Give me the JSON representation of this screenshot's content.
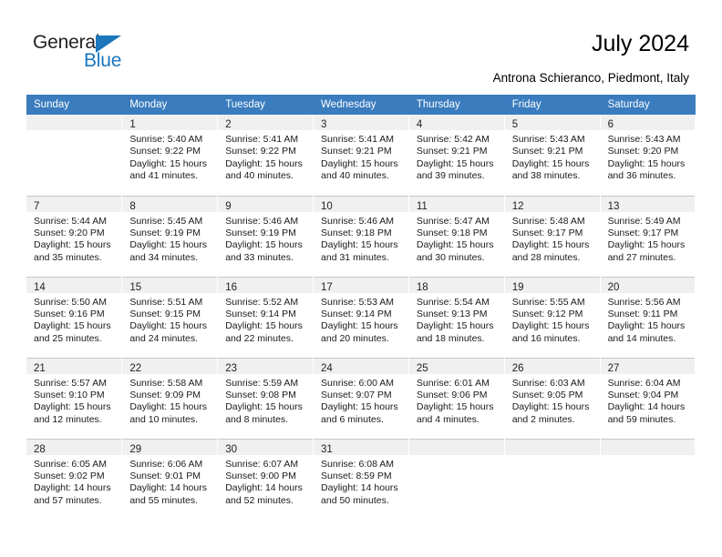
{
  "brand": {
    "word_one": "General",
    "word_two": "Blue",
    "triangle_color": "#1b76bc"
  },
  "header": {
    "title": "July 2024",
    "subtitle": "Antrona Schieranco, Piedmont, Italy"
  },
  "theme": {
    "header_row_bg": "#3a7cbe",
    "daynum_band_bg": "#f0f0f0",
    "grid_line": "#c8c8c8"
  },
  "weekday_headers": [
    "Sunday",
    "Monday",
    "Tuesday",
    "Wednesday",
    "Thursday",
    "Friday",
    "Saturday"
  ],
  "weeks": [
    [
      {
        "day": "",
        "lines": []
      },
      {
        "day": "1",
        "lines": [
          "Sunrise: 5:40 AM",
          "Sunset: 9:22 PM",
          "Daylight: 15 hours",
          "and 41 minutes."
        ]
      },
      {
        "day": "2",
        "lines": [
          "Sunrise: 5:41 AM",
          "Sunset: 9:22 PM",
          "Daylight: 15 hours",
          "and 40 minutes."
        ]
      },
      {
        "day": "3",
        "lines": [
          "Sunrise: 5:41 AM",
          "Sunset: 9:21 PM",
          "Daylight: 15 hours",
          "and 40 minutes."
        ]
      },
      {
        "day": "4",
        "lines": [
          "Sunrise: 5:42 AM",
          "Sunset: 9:21 PM",
          "Daylight: 15 hours",
          "and 39 minutes."
        ]
      },
      {
        "day": "5",
        "lines": [
          "Sunrise: 5:43 AM",
          "Sunset: 9:21 PM",
          "Daylight: 15 hours",
          "and 38 minutes."
        ]
      },
      {
        "day": "6",
        "lines": [
          "Sunrise: 5:43 AM",
          "Sunset: 9:20 PM",
          "Daylight: 15 hours",
          "and 36 minutes."
        ]
      }
    ],
    [
      {
        "day": "7",
        "lines": [
          "Sunrise: 5:44 AM",
          "Sunset: 9:20 PM",
          "Daylight: 15 hours",
          "and 35 minutes."
        ]
      },
      {
        "day": "8",
        "lines": [
          "Sunrise: 5:45 AM",
          "Sunset: 9:19 PM",
          "Daylight: 15 hours",
          "and 34 minutes."
        ]
      },
      {
        "day": "9",
        "lines": [
          "Sunrise: 5:46 AM",
          "Sunset: 9:19 PM",
          "Daylight: 15 hours",
          "and 33 minutes."
        ]
      },
      {
        "day": "10",
        "lines": [
          "Sunrise: 5:46 AM",
          "Sunset: 9:18 PM",
          "Daylight: 15 hours",
          "and 31 minutes."
        ]
      },
      {
        "day": "11",
        "lines": [
          "Sunrise: 5:47 AM",
          "Sunset: 9:18 PM",
          "Daylight: 15 hours",
          "and 30 minutes."
        ]
      },
      {
        "day": "12",
        "lines": [
          "Sunrise: 5:48 AM",
          "Sunset: 9:17 PM",
          "Daylight: 15 hours",
          "and 28 minutes."
        ]
      },
      {
        "day": "13",
        "lines": [
          "Sunrise: 5:49 AM",
          "Sunset: 9:17 PM",
          "Daylight: 15 hours",
          "and 27 minutes."
        ]
      }
    ],
    [
      {
        "day": "14",
        "lines": [
          "Sunrise: 5:50 AM",
          "Sunset: 9:16 PM",
          "Daylight: 15 hours",
          "and 25 minutes."
        ]
      },
      {
        "day": "15",
        "lines": [
          "Sunrise: 5:51 AM",
          "Sunset: 9:15 PM",
          "Daylight: 15 hours",
          "and 24 minutes."
        ]
      },
      {
        "day": "16",
        "lines": [
          "Sunrise: 5:52 AM",
          "Sunset: 9:14 PM",
          "Daylight: 15 hours",
          "and 22 minutes."
        ]
      },
      {
        "day": "17",
        "lines": [
          "Sunrise: 5:53 AM",
          "Sunset: 9:14 PM",
          "Daylight: 15 hours",
          "and 20 minutes."
        ]
      },
      {
        "day": "18",
        "lines": [
          "Sunrise: 5:54 AM",
          "Sunset: 9:13 PM",
          "Daylight: 15 hours",
          "and 18 minutes."
        ]
      },
      {
        "day": "19",
        "lines": [
          "Sunrise: 5:55 AM",
          "Sunset: 9:12 PM",
          "Daylight: 15 hours",
          "and 16 minutes."
        ]
      },
      {
        "day": "20",
        "lines": [
          "Sunrise: 5:56 AM",
          "Sunset: 9:11 PM",
          "Daylight: 15 hours",
          "and 14 minutes."
        ]
      }
    ],
    [
      {
        "day": "21",
        "lines": [
          "Sunrise: 5:57 AM",
          "Sunset: 9:10 PM",
          "Daylight: 15 hours",
          "and 12 minutes."
        ]
      },
      {
        "day": "22",
        "lines": [
          "Sunrise: 5:58 AM",
          "Sunset: 9:09 PM",
          "Daylight: 15 hours",
          "and 10 minutes."
        ]
      },
      {
        "day": "23",
        "lines": [
          "Sunrise: 5:59 AM",
          "Sunset: 9:08 PM",
          "Daylight: 15 hours",
          "and 8 minutes."
        ]
      },
      {
        "day": "24",
        "lines": [
          "Sunrise: 6:00 AM",
          "Sunset: 9:07 PM",
          "Daylight: 15 hours",
          "and 6 minutes."
        ]
      },
      {
        "day": "25",
        "lines": [
          "Sunrise: 6:01 AM",
          "Sunset: 9:06 PM",
          "Daylight: 15 hours",
          "and 4 minutes."
        ]
      },
      {
        "day": "26",
        "lines": [
          "Sunrise: 6:03 AM",
          "Sunset: 9:05 PM",
          "Daylight: 15 hours",
          "and 2 minutes."
        ]
      },
      {
        "day": "27",
        "lines": [
          "Sunrise: 6:04 AM",
          "Sunset: 9:04 PM",
          "Daylight: 14 hours",
          "and 59 minutes."
        ]
      }
    ],
    [
      {
        "day": "28",
        "lines": [
          "Sunrise: 6:05 AM",
          "Sunset: 9:02 PM",
          "Daylight: 14 hours",
          "and 57 minutes."
        ]
      },
      {
        "day": "29",
        "lines": [
          "Sunrise: 6:06 AM",
          "Sunset: 9:01 PM",
          "Daylight: 14 hours",
          "and 55 minutes."
        ]
      },
      {
        "day": "30",
        "lines": [
          "Sunrise: 6:07 AM",
          "Sunset: 9:00 PM",
          "Daylight: 14 hours",
          "and 52 minutes."
        ]
      },
      {
        "day": "31",
        "lines": [
          "Sunrise: 6:08 AM",
          "Sunset: 8:59 PM",
          "Daylight: 14 hours",
          "and 50 minutes."
        ]
      },
      {
        "day": "",
        "lines": []
      },
      {
        "day": "",
        "lines": []
      },
      {
        "day": "",
        "lines": []
      }
    ]
  ]
}
